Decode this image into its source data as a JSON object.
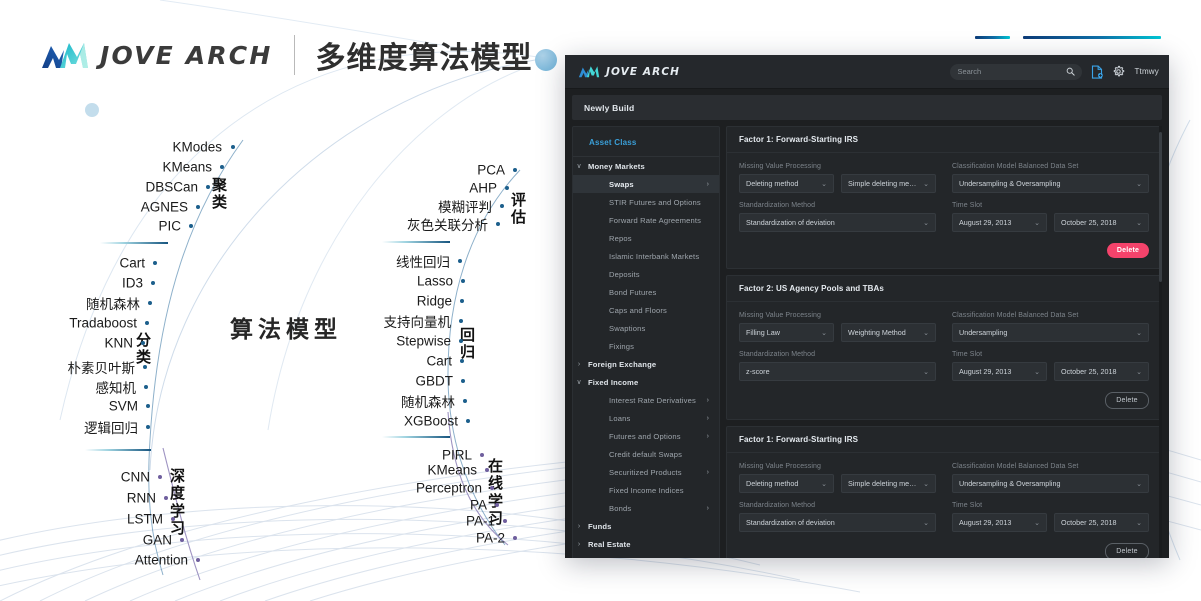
{
  "brand": {
    "logo_icon": "jove-arch-logo",
    "wordmark": "JOVE ARCH",
    "subtitle": "多维度算法模型"
  },
  "algo_map": {
    "center_label": "算法模型",
    "groups": [
      {
        "id": "clustering",
        "label": "聚\n类",
        "nodes": [
          "KModes",
          "KMeans",
          "DBSCan",
          "AGNES",
          "PIC"
        ]
      },
      {
        "id": "evaluation",
        "label": "评\n估",
        "nodes": [
          "PCA",
          "AHP",
          "模糊评判",
          "灰色关联分析"
        ]
      },
      {
        "id": "classification",
        "label": "分\n类",
        "nodes": [
          "Cart",
          "ID3",
          "随机森林",
          "Tradaboost",
          "KNN",
          "朴素贝叶斯",
          "感知机",
          "SVM",
          "逻辑回归"
        ]
      },
      {
        "id": "regression",
        "label": "回\n归",
        "nodes": [
          "线性回归",
          "Lasso",
          "Ridge",
          "支持向量机",
          "Stepwise",
          "Cart",
          "GBDT",
          "随机森林",
          "XGBoost"
        ]
      },
      {
        "id": "deep-learning",
        "label": "深\n度\n学\n习",
        "nodes": [
          "CNN",
          "RNN",
          "LSTM",
          "GAN",
          "Attention"
        ]
      },
      {
        "id": "online-learning",
        "label": "在\n线\n学\n习",
        "nodes": [
          "PIRL",
          "KMeans",
          "Perceptron",
          "PA",
          "PA-1",
          "PA-2"
        ]
      }
    ],
    "group_label_clustering": "聚类",
    "group_label_evaluation": "评估",
    "group_label_classification": "分类",
    "group_label_regression": "回归",
    "group_label_deep": "深度学习",
    "group_label_online": "在线学习"
  },
  "app": {
    "topbar": {
      "logo_icon": "jove-arch-logo-small",
      "wordmark": "JOVE ARCH",
      "search": {
        "value": "",
        "placeholder": "Search",
        "icon": "search-icon"
      },
      "new_doc_icon": "new-document-icon",
      "settings_icon": "gear-icon",
      "username": "Ttmwy"
    },
    "tab": {
      "label": "Newly Build"
    },
    "sidebar": {
      "title": "Asset Class",
      "items": [
        {
          "label": "Money Markets",
          "level": 0,
          "caret": "chevron-down",
          "expanded": true
        },
        {
          "label": "Swaps",
          "level": 1,
          "active": true,
          "arrow": ">"
        },
        {
          "label": "STIR Futures and Options",
          "level": 1
        },
        {
          "label": "Forward Rate Agreements",
          "level": 1
        },
        {
          "label": "Repos",
          "level": 1
        },
        {
          "label": "Islamic Interbank Markets",
          "level": 1
        },
        {
          "label": "Deposits",
          "level": 1
        },
        {
          "label": "Bond Futures",
          "level": 1
        },
        {
          "label": "Caps and Floors",
          "level": 1
        },
        {
          "label": "Swaptions",
          "level": 1
        },
        {
          "label": "Fixings",
          "level": 1
        },
        {
          "label": "Foreign Exchange",
          "level": 0,
          "caret": "chevron-right",
          "expanded": false
        },
        {
          "label": "Fixed Income",
          "level": 0,
          "caret": "chevron-down",
          "expanded": true
        },
        {
          "label": "Interest Rate Derivatives",
          "level": 1,
          "arrow": ">"
        },
        {
          "label": "Loans",
          "level": 1,
          "arrow": ">"
        },
        {
          "label": "Futures and Options",
          "level": 1,
          "arrow": ">"
        },
        {
          "label": "Credit default Swaps",
          "level": 1
        },
        {
          "label": "Securitized Products",
          "level": 1,
          "arrow": ">"
        },
        {
          "label": "Fixed Income Indices",
          "level": 1
        },
        {
          "label": "Bonds",
          "level": 1,
          "arrow": ">"
        },
        {
          "label": "Funds",
          "level": 0,
          "caret": "chevron-right",
          "expanded": false
        },
        {
          "label": "Real Estate",
          "level": 0,
          "caret": "chevron-right",
          "expanded": false
        }
      ]
    },
    "field_labels": {
      "missing_value": "Missing Value Processing",
      "standardization": "Standardization Method",
      "balanced_data": "Classification Model Balanced Data Set",
      "time_slot": "Time Slot"
    },
    "cards": [
      {
        "title": "Factor 1: Forward-Starting IRS",
        "missing_value_a": "Deleting method",
        "missing_value_b": "Simple deleting method",
        "standardization": "Standardization of deviation",
        "balanced_data": "Undersampling & Oversampling",
        "time_from": "August 29, 2013",
        "time_to": "October 25, 2018",
        "delete_label": "Delete",
        "delete_style": "danger"
      },
      {
        "title": "Factor 2: US Agency Pools and TBAs",
        "missing_value_a": "Filling Law",
        "missing_value_b": "Weighting Method",
        "standardization": "z-score",
        "balanced_data": "Undersampling",
        "time_from": "August 29, 2013",
        "time_to": "October 25, 2018",
        "delete_label": "Delete",
        "delete_style": "ghost"
      },
      {
        "title": "Factor 1: Forward-Starting IRS",
        "missing_value_a": "Deleting method",
        "missing_value_b": "Simple deleting method",
        "standardization": "Standardization of deviation",
        "balanced_data": "Undersampling & Oversampling",
        "time_from": "August 29, 2013",
        "time_to": "October 25, 2018",
        "delete_label": "Delete",
        "delete_style": "ghost"
      }
    ]
  },
  "colors": {
    "accent_cyan": "#00c6d4",
    "accent_blue": "#0d3b78",
    "sidebar_title": "#3a9fd8",
    "danger": "#f4436b",
    "app_bg": "#1d1f21",
    "card_bg": "#232629"
  }
}
